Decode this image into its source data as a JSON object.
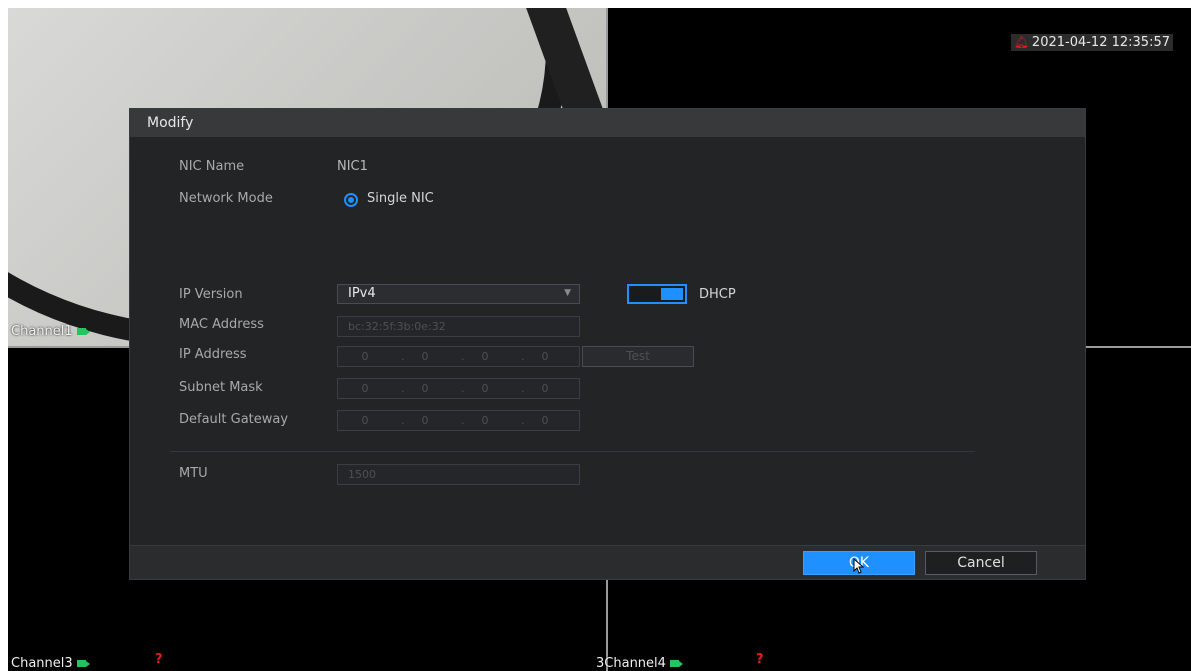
{
  "timestamp": "2021-04-12 12:35:57",
  "channels": [
    {
      "label": "Channel1"
    },
    {
      "label": "Channel3"
    },
    {
      "label": "Channel4",
      "prefix": "3"
    }
  ],
  "dialog": {
    "title": "Modify",
    "nic_name_label": "NIC Name",
    "nic_name_value": "NIC1",
    "network_mode_label": "Network Mode",
    "network_mode_value": "Single NIC",
    "ip_version_label": "IP Version",
    "ip_version_value": "IPv4",
    "dhcp_label": "DHCP",
    "mac_label": "MAC Address",
    "mac_value": "bc:32:5f:3b:0e:32",
    "ip_label": "IP Address",
    "ip_value": [
      "0",
      "0",
      "0",
      "0"
    ],
    "test_label": "Test",
    "subnet_label": "Subnet Mask",
    "subnet_value": [
      "0",
      "0",
      "0",
      "0"
    ],
    "gateway_label": "Default Gateway",
    "gateway_value": [
      "0",
      "0",
      "0",
      "0"
    ],
    "mtu_label": "MTU",
    "mtu_value": "1500",
    "ok_label": "OK",
    "cancel_label": "Cancel"
  },
  "colors": {
    "accent": "#1e90ff",
    "record": "#22c55e",
    "alarm": "#e11d1d"
  }
}
